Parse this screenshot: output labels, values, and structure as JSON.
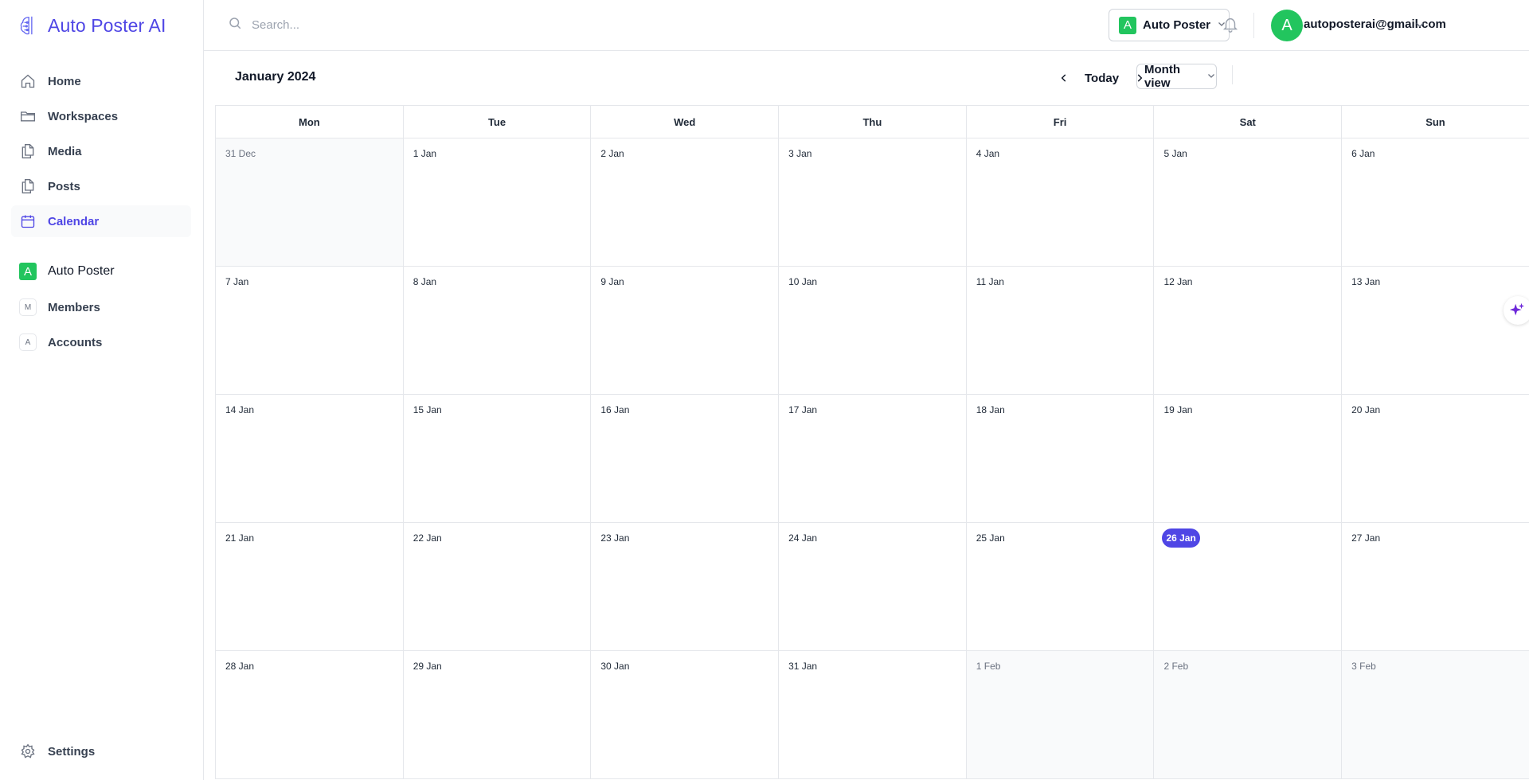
{
  "app": {
    "name": "Auto Poster AI",
    "brand_color": "#4f46e5",
    "accent_green": "#22c55e"
  },
  "sidebar": {
    "items": [
      {
        "label": "Home",
        "icon": "home-icon"
      },
      {
        "label": "Workspaces",
        "icon": "folder-icon"
      },
      {
        "label": "Media",
        "icon": "files-icon"
      },
      {
        "label": "Posts",
        "icon": "document-icon"
      },
      {
        "label": "Calendar",
        "icon": "calendar-icon",
        "active": true
      }
    ],
    "workspace": {
      "badge": "A",
      "name": "Auto Poster",
      "items": [
        {
          "letter": "M",
          "label": "Members"
        },
        {
          "letter": "A",
          "label": "Accounts"
        }
      ]
    },
    "settings_label": "Settings"
  },
  "topbar": {
    "search_placeholder": "Search...",
    "workspace_switcher": {
      "badge": "A",
      "label": "Auto Poster"
    },
    "user": {
      "avatar_letter": "A",
      "email": "autoposterai@gmail.com"
    }
  },
  "calendar": {
    "title": "January 2024",
    "today_label": "Today",
    "view_label": "Month view",
    "weekdays": [
      "Mon",
      "Tue",
      "Wed",
      "Thu",
      "Fri",
      "Sat",
      "Sun"
    ],
    "weeks": [
      [
        {
          "label": "31 Dec",
          "muted": true
        },
        {
          "label": "1 Jan"
        },
        {
          "label": "2 Jan"
        },
        {
          "label": "3 Jan"
        },
        {
          "label": "4 Jan"
        },
        {
          "label": "5 Jan"
        },
        {
          "label": "6 Jan"
        }
      ],
      [
        {
          "label": "7 Jan"
        },
        {
          "label": "8 Jan"
        },
        {
          "label": "9 Jan"
        },
        {
          "label": "10 Jan"
        },
        {
          "label": "11 Jan"
        },
        {
          "label": "12 Jan"
        },
        {
          "label": "13 Jan"
        }
      ],
      [
        {
          "label": "14 Jan"
        },
        {
          "label": "15 Jan"
        },
        {
          "label": "16 Jan"
        },
        {
          "label": "17 Jan"
        },
        {
          "label": "18 Jan"
        },
        {
          "label": "19 Jan"
        },
        {
          "label": "20 Jan"
        }
      ],
      [
        {
          "label": "21 Jan"
        },
        {
          "label": "22 Jan"
        },
        {
          "label": "23 Jan"
        },
        {
          "label": "24 Jan"
        },
        {
          "label": "25 Jan"
        },
        {
          "label": "26 Jan",
          "today": true
        },
        {
          "label": "27 Jan"
        }
      ],
      [
        {
          "label": "28 Jan"
        },
        {
          "label": "29 Jan"
        },
        {
          "label": "30 Jan"
        },
        {
          "label": "31 Jan"
        },
        {
          "label": "1 Feb",
          "muted": true
        },
        {
          "label": "2 Feb",
          "muted": true
        },
        {
          "label": "3 Feb",
          "muted": true
        }
      ]
    ]
  }
}
